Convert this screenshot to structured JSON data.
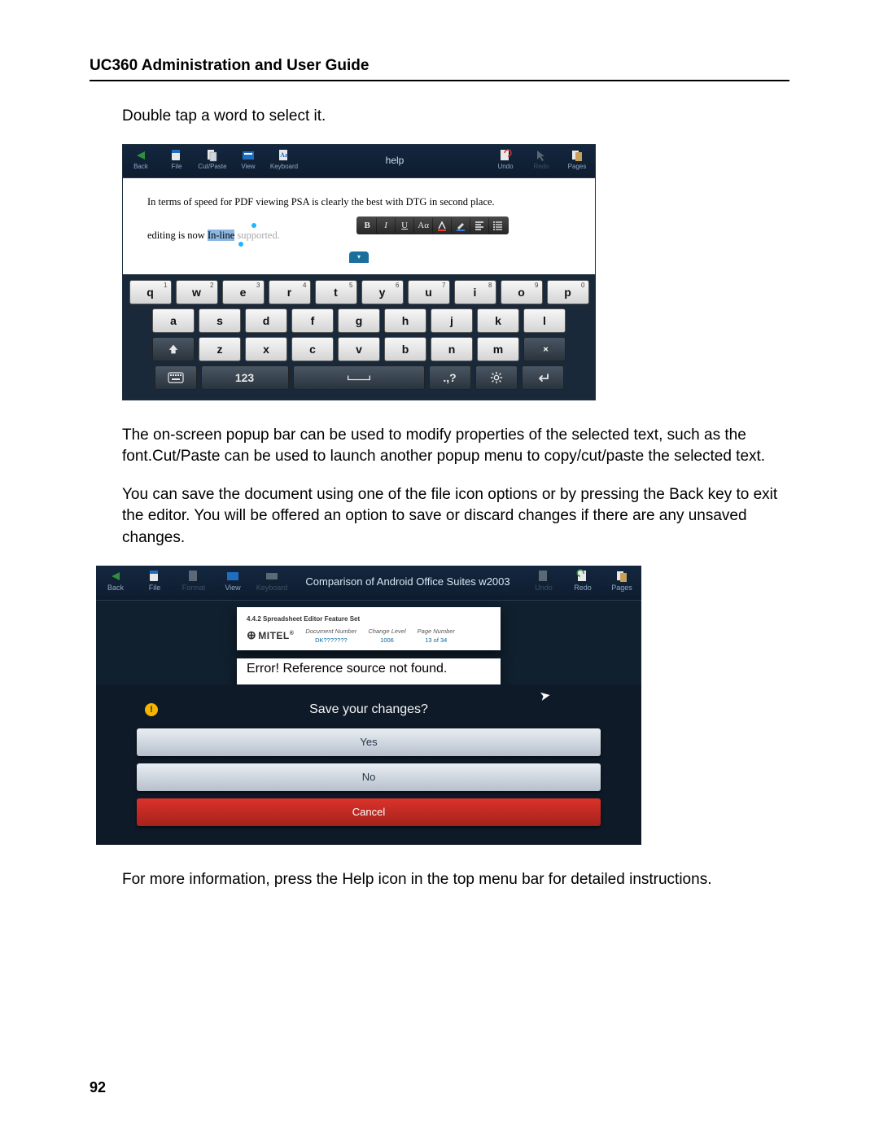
{
  "doc": {
    "header": "UC360 Administration and User Guide",
    "intro": "Double tap a word to select it.",
    "p1": "The on-screen popup bar can be used to modify properties of the selected text, such as the font.Cut/Paste can be used to launch another popup menu to copy/cut/paste the selected text.",
    "p2": "You can save the document using one of the file icon options or by pressing the Back key to exit the editor. You will be offered an option to save or discard changes if there are any unsaved changes.",
    "p3": "For more information, press the Help icon in the top menu bar for detailed instructions.",
    "page_number": "92"
  },
  "shot1": {
    "toolbar": {
      "back": "Back",
      "file": "File",
      "cutpaste": "Cut/Paste",
      "view": "View",
      "keyboard": "Keyboard",
      "title": "help",
      "undo": "Undo",
      "redo": "Redo",
      "pages": "Pages"
    },
    "content": {
      "line1": "In terms of speed for PDF viewing PSA is clearly the best with DTG in second place.",
      "line2a": "editing is now ",
      "line2sel": "In-line",
      "line2b": " supported."
    },
    "popup": {
      "bold": "B",
      "italic": "I",
      "underline": "U",
      "font": "Aα",
      "color1": "c",
      "color2": "c",
      "align": "≡",
      "list": "≣"
    },
    "keyboard": {
      "row1": [
        {
          "k": "q",
          "s": "1"
        },
        {
          "k": "w",
          "s": "2"
        },
        {
          "k": "e",
          "s": "3"
        },
        {
          "k": "r",
          "s": "4"
        },
        {
          "k": "t",
          "s": "5"
        },
        {
          "k": "y",
          "s": "6"
        },
        {
          "k": "u",
          "s": "7"
        },
        {
          "k": "i",
          "s": "8"
        },
        {
          "k": "o",
          "s": "9"
        },
        {
          "k": "p",
          "s": "0"
        }
      ],
      "row2": [
        {
          "k": "a"
        },
        {
          "k": "s"
        },
        {
          "k": "d"
        },
        {
          "k": "f"
        },
        {
          "k": "g"
        },
        {
          "k": "h"
        },
        {
          "k": "j"
        },
        {
          "k": "k"
        },
        {
          "k": "l"
        }
      ],
      "row3": {
        "shift": "⇧",
        "keys": [
          {
            "k": "z"
          },
          {
            "k": "x"
          },
          {
            "k": "c"
          },
          {
            "k": "v"
          },
          {
            "k": "b"
          },
          {
            "k": "n"
          },
          {
            "k": "m"
          }
        ],
        "backspace": "⌫"
      },
      "row4": {
        "menu": "⌨",
        "numeric": "123",
        "space": "␣",
        "punct": ".,?",
        "settings": "⚙",
        "enter": "↵"
      }
    }
  },
  "shot2": {
    "toolbar": {
      "back": "Back",
      "file": "File",
      "format": "Format",
      "view": "View",
      "keyboard": "Keyboard",
      "title": "Comparison of Android Office Suites w2003",
      "undo": "Undo",
      "redo": "Redo",
      "pages": "Pages"
    },
    "paper": {
      "heading": "4.4.2   Spreadsheet Editor Feature Set",
      "brand": "MITEL",
      "reg": "®",
      "fields": {
        "docnum_lbl": "Document Number",
        "docnum_val": "DK???????",
        "change_lbl": "Change Level",
        "change_val": "1006",
        "page_lbl": "Page Number",
        "page_val": "13 of 34"
      },
      "error": "Error! Reference source not found."
    },
    "dialog": {
      "title": "Save your changes?",
      "yes": "Yes",
      "no": "No",
      "cancel": "Cancel",
      "warn": "!"
    }
  }
}
